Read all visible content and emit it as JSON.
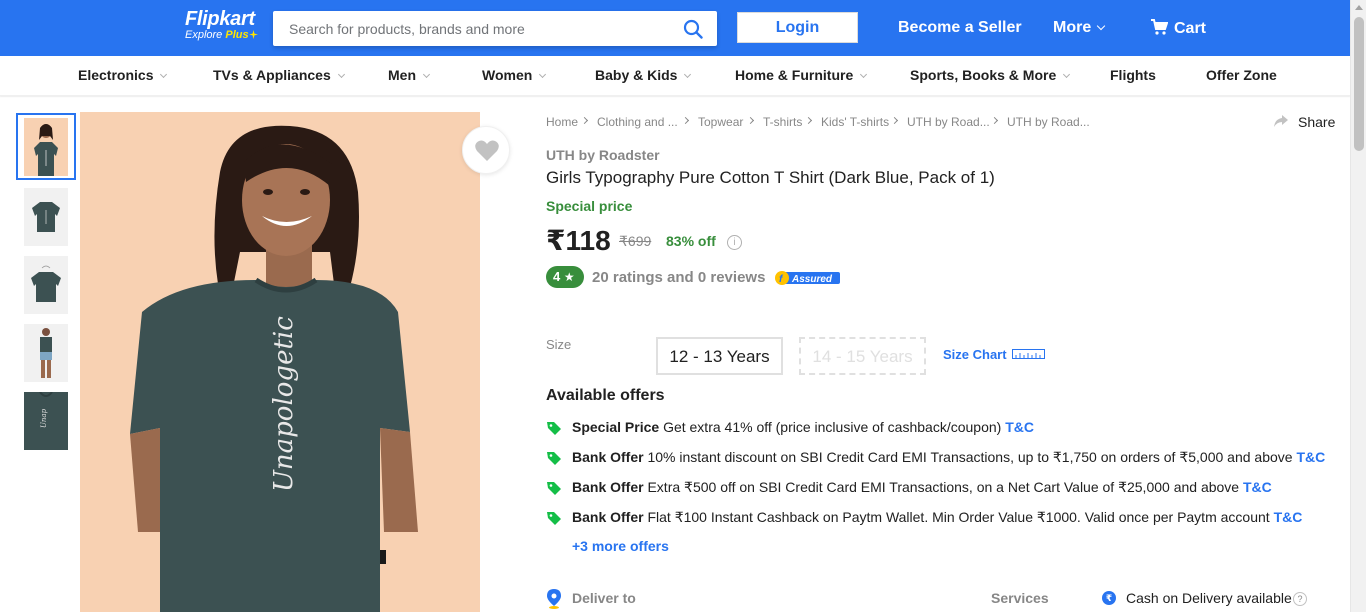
{
  "header": {
    "logo_main": "Flipkart",
    "logo_sub_prefix": "Explore ",
    "logo_sub_plus": "Plus",
    "search_placeholder": "Search for products, brands and more",
    "login_label": "Login",
    "become_seller_label": "Become a Seller",
    "more_label": "More",
    "cart_label": "Cart",
    "brand_color": "#2874f0",
    "accent_color": "#ffe500"
  },
  "nav": {
    "items": [
      {
        "label": "Electronics",
        "dropdown": true
      },
      {
        "label": "TVs & Appliances",
        "dropdown": true
      },
      {
        "label": "Men",
        "dropdown": true
      },
      {
        "label": "Women",
        "dropdown": true
      },
      {
        "label": "Baby & Kids",
        "dropdown": true
      },
      {
        "label": "Home & Furniture",
        "dropdown": true
      },
      {
        "label": "Sports, Books & More",
        "dropdown": true
      },
      {
        "label": "Flights",
        "dropdown": false
      },
      {
        "label": "Offer Zone",
        "dropdown": false
      }
    ]
  },
  "gallery": {
    "thumbnail_count": 5,
    "selected_index": 0,
    "shirt_text": "Unapologetic",
    "shirt_color": "#3c5152"
  },
  "breadcrumb": [
    "Home",
    "Clothing and ...",
    "Topwear",
    "T-shirts",
    "Kids' T-shirts",
    "UTH by Road...",
    "UTH by Road..."
  ],
  "share_label": "Share",
  "product": {
    "brand": "UTH by Roadster",
    "title": "Girls Typography Pure Cotton T Shirt  (Dark Blue, Pack of 1)",
    "special_price_label": "Special price",
    "price": "₹118",
    "mrp": "₹699",
    "discount": "83% off",
    "rating": "4",
    "rating_star": "★",
    "ratings_text": "20 ratings and 0 reviews",
    "assured_label": "Assured"
  },
  "size": {
    "label": "Size",
    "options": [
      {
        "label": "12 - 13 Years",
        "available": true
      },
      {
        "label": "14 - 15 Years",
        "available": false
      }
    ],
    "size_chart_label": "Size Chart"
  },
  "offers": {
    "title": "Available offers",
    "items": [
      {
        "type": "Special Price",
        "text": "Get extra 41% off (price inclusive of cashback/coupon)",
        "tc": "T&C"
      },
      {
        "type": "Bank Offer",
        "text": "10% instant discount on SBI Credit Card EMI Transactions, up to ₹1,750 on orders of ₹5,000 and above",
        "tc": "T&C"
      },
      {
        "type": "Bank Offer",
        "text": "Extra ₹500 off on SBI Credit Card EMI Transactions, on a Net Cart Value of ₹25,000 and above",
        "tc": "T&C"
      },
      {
        "type": "Bank Offer",
        "text": "Flat ₹100 Instant Cashback on Paytm Wallet. Min Order Value ₹1000. Valid once per Paytm account",
        "tc": "T&C"
      }
    ],
    "more_label": "+3 more offers"
  },
  "delivery": {
    "deliver_to_label": "Deliver to",
    "services_label": "Services",
    "cod_text": "Cash on Delivery available",
    "rupee_glyph": "₹",
    "help_glyph": "?",
    "info_glyph": "i"
  }
}
